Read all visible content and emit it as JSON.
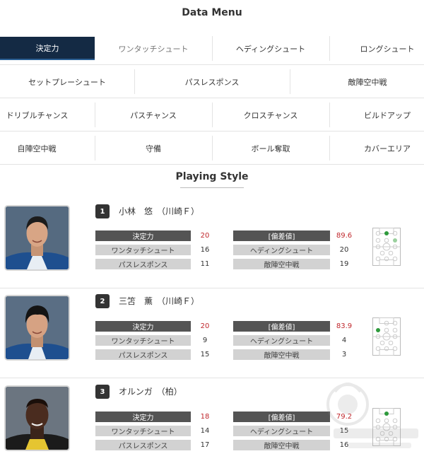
{
  "menu": {
    "title": "Data Menu",
    "rows": [
      [
        "決定力",
        "ワンタッチシュート",
        "ヘディングシュート",
        "ロングシュート"
      ],
      [
        "セットプレーシュート",
        "パスレスポンス",
        "敵陣空中戦"
      ],
      [
        "ドリブルチャンス",
        "パスチャンス",
        "クロスチャンス",
        "ビルドアップ"
      ],
      [
        "自陣空中戦",
        "守備",
        "ボール奪取",
        "カバーエリア"
      ]
    ]
  },
  "section_title": "Playing Style",
  "players": [
    {
      "rank": "1",
      "name": "小林　悠　（川崎Ｆ）",
      "stats": [
        {
          "label": "決定力",
          "value": "20",
          "highlight": true
        },
        {
          "label": "ワンタッチシュート",
          "value": "16",
          "highlight": false
        },
        {
          "label": "パスレスポンス",
          "value": "11",
          "highlight": false
        }
      ],
      "stats2": [
        {
          "label": "[偏差値]",
          "value": "89.6",
          "highlight": true
        },
        {
          "label": "ヘディングシュート",
          "value": "20",
          "highlight": false
        },
        {
          "label": "敵陣空中戦",
          "value": "19",
          "highlight": false
        }
      ]
    },
    {
      "rank": "2",
      "name": "三笘　薫　（川崎Ｆ）",
      "stats": [
        {
          "label": "決定力",
          "value": "20",
          "highlight": true
        },
        {
          "label": "ワンタッチシュート",
          "value": "9",
          "highlight": false
        },
        {
          "label": "パスレスポンス",
          "value": "15",
          "highlight": false
        }
      ],
      "stats2": [
        {
          "label": "[偏差値]",
          "value": "83.9",
          "highlight": true
        },
        {
          "label": "ヘディングシュート",
          "value": "4",
          "highlight": false
        },
        {
          "label": "敵陣空中戦",
          "value": "3",
          "highlight": false
        }
      ]
    },
    {
      "rank": "3",
      "name": "オルンガ　（柏）",
      "stats": [
        {
          "label": "決定力",
          "value": "18",
          "highlight": true
        },
        {
          "label": "ワンタッチシュート",
          "value": "14",
          "highlight": false
        },
        {
          "label": "パスレスポンス",
          "value": "17",
          "highlight": false
        }
      ],
      "stats2": [
        {
          "label": "[偏差値]",
          "value": "79.2",
          "highlight": true
        },
        {
          "label": "ヘディングシュート",
          "value": "15",
          "highlight": false
        },
        {
          "label": "敵陣空中戦",
          "value": "16",
          "highlight": false
        }
      ]
    }
  ],
  "colors": {
    "active_tab": "#142a44",
    "label_dark": "#545454",
    "label_light": "#d2d2d2",
    "highlight_value": "#c0282d",
    "position_active": "#2e9a3c",
    "position_secondary": "#9bd09e"
  }
}
